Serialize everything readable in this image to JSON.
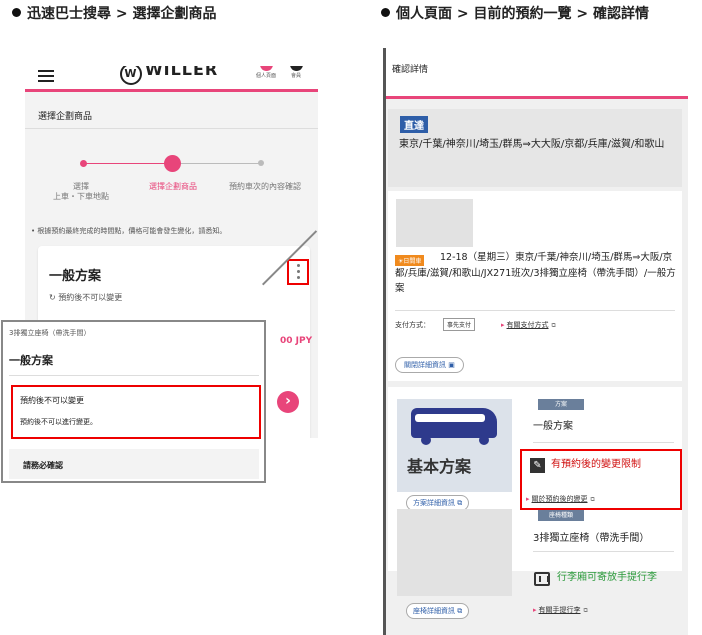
{
  "captions": {
    "left": "迅速巴士搜尋 > 選擇企劃商品",
    "right": "個人頁面 > 目前的預約一覽 > 確認詳情"
  },
  "left_screen": {
    "logo_text": "WILLER",
    "logo_mark": "W",
    "header_icons": [
      {
        "icon": "person-icon",
        "label": "個人頁面"
      },
      {
        "icon": "member-icon",
        "label": "會員"
      }
    ],
    "page_title": "選擇企劃商品",
    "steps": [
      {
        "label": "選擇\n上車・下車地點"
      },
      {
        "label": "選擇企劃商品",
        "active": true
      },
      {
        "label": "預約車次的內容確認"
      }
    ],
    "note": "• 根據預約最終完成的時間點，價格可能會發生變化，請悉知。",
    "plan_card": {
      "name": "一般方案",
      "sub": "預約後不可以變更",
      "price_fragment": "00 JPY",
      "next_icon": "chevron-right-icon"
    },
    "popup": {
      "header": "3排獨立座椅（帶洗手間）",
      "title": "一般方案",
      "restriction_title": "預約後不可以變更",
      "restriction_text": "預約後不可以進行變更。",
      "terms": "請務必確認"
    }
  },
  "right_screen": {
    "title": "確認詳情",
    "direct_badge": "直達",
    "route": "東京/千葉/神奈川/埼玉/群馬⇒大大阪/京都/兵庫/滋賀/和歌山",
    "day_badge": "☀日間車",
    "trip_info": "12-18（星期三）東京/千葉/神奈川/埼玉/群馬⇒大阪/京都/兵庫/滋賀/和歌山/JX271班次/3排獨立座椅（帶洗手間）/一般方案",
    "payment_label": "支付方式：",
    "payment_chip": "事先支付",
    "payment_link": "有關支付方式",
    "close_button": "關閉詳細資訊",
    "bus_label": "基本方案",
    "plan_detail_button": "方案詳細資訊",
    "plan_tag": "方案",
    "plan_value": "一般方案",
    "restriction_text": "有預約後的變更限制",
    "restriction_link": "關於預約後的變更",
    "seat_tag": "座椅種類",
    "seat_value": "3排獨立座椅（帶洗手間）",
    "seat_detail_button": "座椅詳細資訊",
    "luggage_text": "行李廂可寄放手提行李",
    "luggage_link": "有關手提行李"
  },
  "colors": {
    "brand_pink": "#e8457a",
    "highlight_red": "#e00000",
    "direct_blue": "#2e5ea8",
    "restriction_red": "#d01010",
    "luggage_green": "#2a9a3a"
  }
}
